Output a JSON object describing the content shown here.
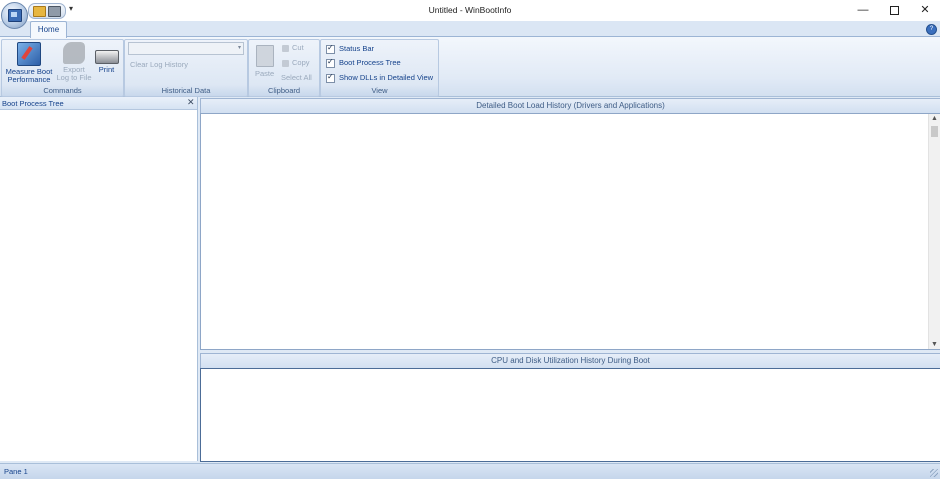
{
  "window": {
    "title": "Untitled - WinBootInfo",
    "minimize_glyph": "—",
    "close_glyph": "✕"
  },
  "quick_access": {
    "customize_glyph": "▾"
  },
  "ribbon": {
    "tabs": [
      {
        "label": "Home",
        "active": true
      }
    ],
    "groups": {
      "commands": {
        "label": "Commands",
        "measure_line1": "Measure Boot",
        "measure_line2": "Performance",
        "export_line1": "Export",
        "export_line2": "Log to File",
        "print": "Print"
      },
      "historical": {
        "label": "Historical Data",
        "combo_value": "",
        "clear_log": "Clear Log History"
      },
      "clipboard": {
        "label": "Clipboard",
        "paste": "Paste",
        "cut": "Cut",
        "copy": "Copy",
        "select_all": "Select All"
      },
      "view": {
        "label": "View",
        "status_bar": "Status Bar",
        "boot_process_tree": "Boot Process Tree",
        "show_dlls": "Show DLLs in Detailed View"
      }
    }
  },
  "left_pane": {
    "title": "Boot Process Tree",
    "close_glyph": "✕"
  },
  "detail_pane": {
    "title": "Detailed Boot Load History (Drivers and Applications)"
  },
  "cpu_pane": {
    "title": "CPU and Disk Utilization History During Boot"
  },
  "status_bar": {
    "text": "Pane 1"
  },
  "icons": {
    "app_menu": "app-menu-icon",
    "open": "open-folder-icon",
    "print": "printer-icon",
    "help": "help-icon",
    "measure": "measure-boot-icon",
    "export": "export-icon",
    "paste": "paste-icon",
    "cut": "scissors-icon",
    "copy": "copy-icon"
  },
  "colors": {
    "ribbon_bg": "#dfe9f5",
    "accent": "#15428b",
    "disabled_text": "#9aa9bc"
  }
}
